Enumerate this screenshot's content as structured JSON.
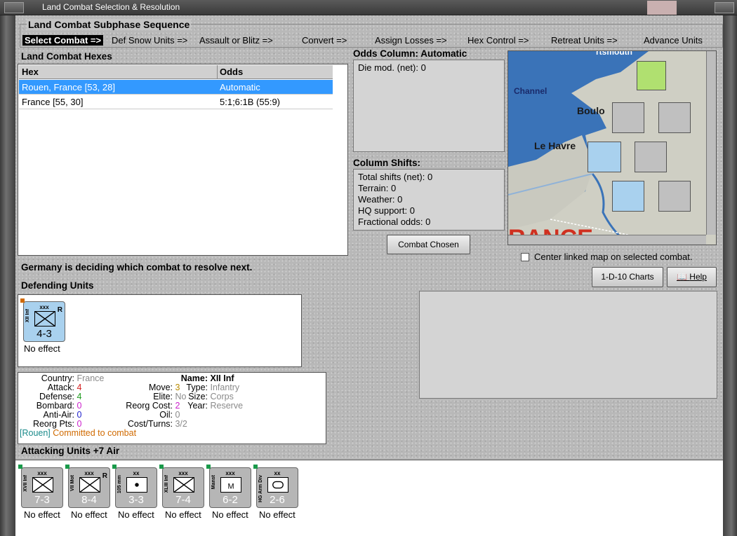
{
  "window": {
    "title": "Land Combat Selection & Resolution"
  },
  "sequence": {
    "title": "Land Combat Subphase Sequence",
    "steps": [
      "Select Combat =>",
      "Def Snow Units =>",
      "Assault or Blitz =>",
      "Convert =>",
      "Assign Losses =>",
      "Hex Control =>",
      "Retreat Units =>",
      "Advance Units"
    ]
  },
  "hexes": {
    "title": "Land Combat Hexes",
    "columns": [
      "Hex",
      "Odds"
    ],
    "rows": [
      {
        "hex": "Rouen, France [53, 28]",
        "odds": "Automatic"
      },
      {
        "hex": "France [55, 30]",
        "odds": "5:1;6:1B (55:9)"
      }
    ]
  },
  "odds": {
    "title": "Odds Column: Automatic",
    "die_mod": "Die mod. (net): 0"
  },
  "shifts": {
    "title": "Column Shifts:",
    "lines": [
      "Total shifts (net): 0",
      "Terrain: 0",
      "Weather: 0",
      "HQ support: 0",
      "Fractional odds: 0"
    ]
  },
  "buttons": {
    "combat_chosen": "Combat Chosen",
    "charts": "1-D-10 Charts",
    "help": "Help"
  },
  "map": {
    "labels": [
      "Channel",
      "Boulo",
      "Le Havre",
      "RANCE",
      "rtsmouth"
    ],
    "center_label": "Center linked map on selected combat."
  },
  "status": "Germany is deciding which combat to resolve next.",
  "defending": {
    "title": "Defending Units",
    "units": [
      {
        "name": "XII Inf",
        "size": "xxx",
        "strength": "4-3",
        "reserve": "R",
        "effect": "No effect"
      }
    ]
  },
  "info": {
    "country_l": "Country:",
    "country": "France",
    "attack_l": "Attack:",
    "attack": "4",
    "defense_l": "Defense:",
    "defense": "4",
    "bombard_l": "Bombard:",
    "bombard": "0",
    "aa_l": "Anti-Air:",
    "aa": "0",
    "reorg_l": "Reorg Pts:",
    "reorg": "0",
    "move_l": "Move:",
    "move": "3",
    "elite_l": "Elite:",
    "elite": "No",
    "rcost_l": "Reorg Cost:",
    "rcost": "2",
    "oil_l": "Oil:",
    "oil": "0",
    "ct_l": "Cost/Turns:",
    "ct": "3/2",
    "name_l": "Name:",
    "name": "XII Inf",
    "type_l": "Type:",
    "type": "Infantry",
    "size_l": "Size:",
    "size": "Corps",
    "year_l": "Year:",
    "year": "Reserve",
    "loc": "[Rouen]",
    "status": "Committed to combat"
  },
  "attacking": {
    "title": "Attacking Units +7 Air",
    "units": [
      {
        "name": "XVII Inf",
        "size": "xxx",
        "strength": "7-3",
        "effect": "No effect",
        "reserve": ""
      },
      {
        "name": "VII Mot",
        "size": "xxx",
        "strength": "8-4",
        "effect": "No effect",
        "reserve": "R"
      },
      {
        "name": "105 mm",
        "size": "xx",
        "strength": "3-3",
        "effect": "No effect",
        "reserve": ""
      },
      {
        "name": "XLIII Inf",
        "size": "xxx",
        "strength": "7-4",
        "effect": "No effect",
        "reserve": ""
      },
      {
        "name": "Manst",
        "size": "xxx",
        "strength": "6-2",
        "effect": "No effect",
        "reserve": ""
      },
      {
        "name": "HG Arm Div",
        "size": "xx",
        "strength": "2-6",
        "effect": "No effect",
        "reserve": ""
      }
    ]
  },
  "colors": {
    "attack": "#d42020",
    "defense": "#1f9a1f",
    "bombard": "#cc22cc",
    "aa": "#2222cc",
    "reorg": "#cc22cc",
    "move": "#b88a00",
    "rcost": "#cc22cc",
    "loc": "#1a8a8a",
    "status": "#d06a00",
    "muted": "#8a8a8a"
  }
}
